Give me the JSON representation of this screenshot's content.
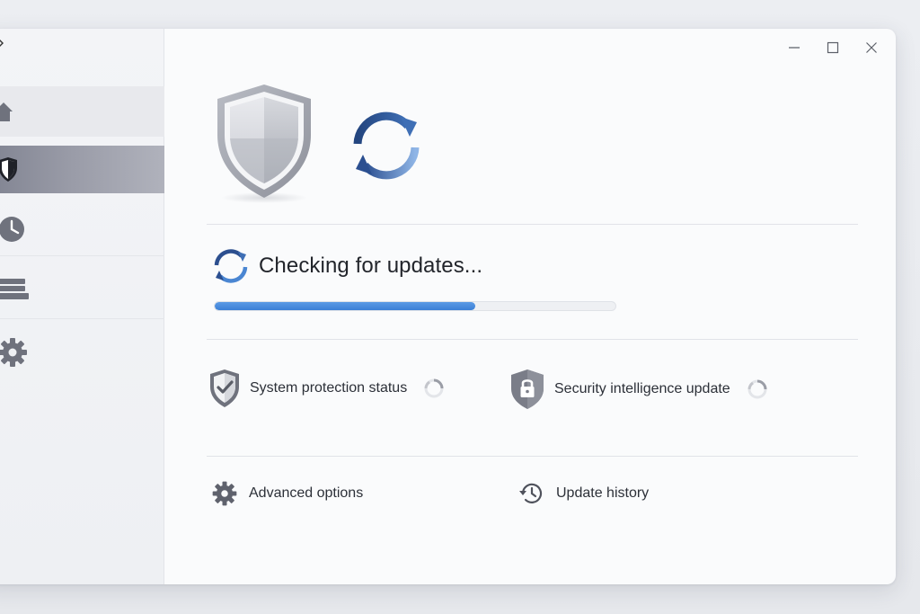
{
  "window": {
    "controls": {
      "minimize": "minimize",
      "maximize": "maximize",
      "close": "close"
    }
  },
  "sidebar": {
    "items": [
      {
        "id": "home",
        "icon": "home-icon",
        "selected": false
      },
      {
        "id": "protection",
        "icon": "shield-icon",
        "selected": true
      },
      {
        "id": "history",
        "icon": "clock-icon",
        "selected": false
      },
      {
        "id": "library",
        "icon": "library-icon",
        "selected": false
      },
      {
        "id": "settings",
        "icon": "gear-icon",
        "selected": false
      }
    ]
  },
  "main": {
    "status": {
      "title": "Checking for updates...",
      "progress_percent": 65
    },
    "checks": [
      {
        "label": "System protection status",
        "icon": "shield-check-icon",
        "state": "loading"
      },
      {
        "label": "Security intelligence update",
        "icon": "shield-lock-icon",
        "state": "loading"
      }
    ],
    "links": [
      {
        "label": "Advanced options",
        "icon": "gear-icon"
      },
      {
        "label": "Update history",
        "icon": "history-icon"
      }
    ]
  },
  "colors": {
    "accent": "#3b7fd6",
    "sync_dark": "#2c4f8f",
    "sync_light": "#5b9be5",
    "selected_nav": "#8a8d99",
    "icon_gray": "#6f727d"
  }
}
